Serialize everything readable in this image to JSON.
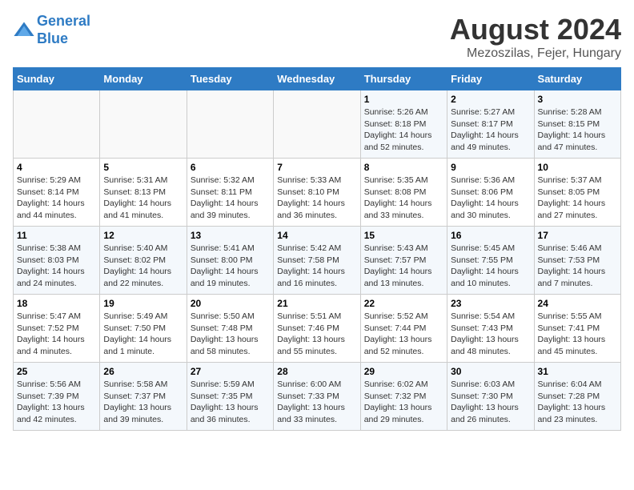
{
  "header": {
    "logo_line1": "General",
    "logo_line2": "Blue",
    "main_title": "August 2024",
    "subtitle": "Mezoszilas, Fejer, Hungary"
  },
  "days_of_week": [
    "Sunday",
    "Monday",
    "Tuesday",
    "Wednesday",
    "Thursday",
    "Friday",
    "Saturday"
  ],
  "weeks": [
    [
      {
        "day": "",
        "info": ""
      },
      {
        "day": "",
        "info": ""
      },
      {
        "day": "",
        "info": ""
      },
      {
        "day": "",
        "info": ""
      },
      {
        "day": "1",
        "info": "Sunrise: 5:26 AM\nSunset: 8:18 PM\nDaylight: 14 hours\nand 52 minutes."
      },
      {
        "day": "2",
        "info": "Sunrise: 5:27 AM\nSunset: 8:17 PM\nDaylight: 14 hours\nand 49 minutes."
      },
      {
        "day": "3",
        "info": "Sunrise: 5:28 AM\nSunset: 8:15 PM\nDaylight: 14 hours\nand 47 minutes."
      }
    ],
    [
      {
        "day": "4",
        "info": "Sunrise: 5:29 AM\nSunset: 8:14 PM\nDaylight: 14 hours\nand 44 minutes."
      },
      {
        "day": "5",
        "info": "Sunrise: 5:31 AM\nSunset: 8:13 PM\nDaylight: 14 hours\nand 41 minutes."
      },
      {
        "day": "6",
        "info": "Sunrise: 5:32 AM\nSunset: 8:11 PM\nDaylight: 14 hours\nand 39 minutes."
      },
      {
        "day": "7",
        "info": "Sunrise: 5:33 AM\nSunset: 8:10 PM\nDaylight: 14 hours\nand 36 minutes."
      },
      {
        "day": "8",
        "info": "Sunrise: 5:35 AM\nSunset: 8:08 PM\nDaylight: 14 hours\nand 33 minutes."
      },
      {
        "day": "9",
        "info": "Sunrise: 5:36 AM\nSunset: 8:06 PM\nDaylight: 14 hours\nand 30 minutes."
      },
      {
        "day": "10",
        "info": "Sunrise: 5:37 AM\nSunset: 8:05 PM\nDaylight: 14 hours\nand 27 minutes."
      }
    ],
    [
      {
        "day": "11",
        "info": "Sunrise: 5:38 AM\nSunset: 8:03 PM\nDaylight: 14 hours\nand 24 minutes."
      },
      {
        "day": "12",
        "info": "Sunrise: 5:40 AM\nSunset: 8:02 PM\nDaylight: 14 hours\nand 22 minutes."
      },
      {
        "day": "13",
        "info": "Sunrise: 5:41 AM\nSunset: 8:00 PM\nDaylight: 14 hours\nand 19 minutes."
      },
      {
        "day": "14",
        "info": "Sunrise: 5:42 AM\nSunset: 7:58 PM\nDaylight: 14 hours\nand 16 minutes."
      },
      {
        "day": "15",
        "info": "Sunrise: 5:43 AM\nSunset: 7:57 PM\nDaylight: 14 hours\nand 13 minutes."
      },
      {
        "day": "16",
        "info": "Sunrise: 5:45 AM\nSunset: 7:55 PM\nDaylight: 14 hours\nand 10 minutes."
      },
      {
        "day": "17",
        "info": "Sunrise: 5:46 AM\nSunset: 7:53 PM\nDaylight: 14 hours\nand 7 minutes."
      }
    ],
    [
      {
        "day": "18",
        "info": "Sunrise: 5:47 AM\nSunset: 7:52 PM\nDaylight: 14 hours\nand 4 minutes."
      },
      {
        "day": "19",
        "info": "Sunrise: 5:49 AM\nSunset: 7:50 PM\nDaylight: 14 hours\nand 1 minute."
      },
      {
        "day": "20",
        "info": "Sunrise: 5:50 AM\nSunset: 7:48 PM\nDaylight: 13 hours\nand 58 minutes."
      },
      {
        "day": "21",
        "info": "Sunrise: 5:51 AM\nSunset: 7:46 PM\nDaylight: 13 hours\nand 55 minutes."
      },
      {
        "day": "22",
        "info": "Sunrise: 5:52 AM\nSunset: 7:44 PM\nDaylight: 13 hours\nand 52 minutes."
      },
      {
        "day": "23",
        "info": "Sunrise: 5:54 AM\nSunset: 7:43 PM\nDaylight: 13 hours\nand 48 minutes."
      },
      {
        "day": "24",
        "info": "Sunrise: 5:55 AM\nSunset: 7:41 PM\nDaylight: 13 hours\nand 45 minutes."
      }
    ],
    [
      {
        "day": "25",
        "info": "Sunrise: 5:56 AM\nSunset: 7:39 PM\nDaylight: 13 hours\nand 42 minutes."
      },
      {
        "day": "26",
        "info": "Sunrise: 5:58 AM\nSunset: 7:37 PM\nDaylight: 13 hours\nand 39 minutes."
      },
      {
        "day": "27",
        "info": "Sunrise: 5:59 AM\nSunset: 7:35 PM\nDaylight: 13 hours\nand 36 minutes."
      },
      {
        "day": "28",
        "info": "Sunrise: 6:00 AM\nSunset: 7:33 PM\nDaylight: 13 hours\nand 33 minutes."
      },
      {
        "day": "29",
        "info": "Sunrise: 6:02 AM\nSunset: 7:32 PM\nDaylight: 13 hours\nand 29 minutes."
      },
      {
        "day": "30",
        "info": "Sunrise: 6:03 AM\nSunset: 7:30 PM\nDaylight: 13 hours\nand 26 minutes."
      },
      {
        "day": "31",
        "info": "Sunrise: 6:04 AM\nSunset: 7:28 PM\nDaylight: 13 hours\nand 23 minutes."
      }
    ]
  ]
}
